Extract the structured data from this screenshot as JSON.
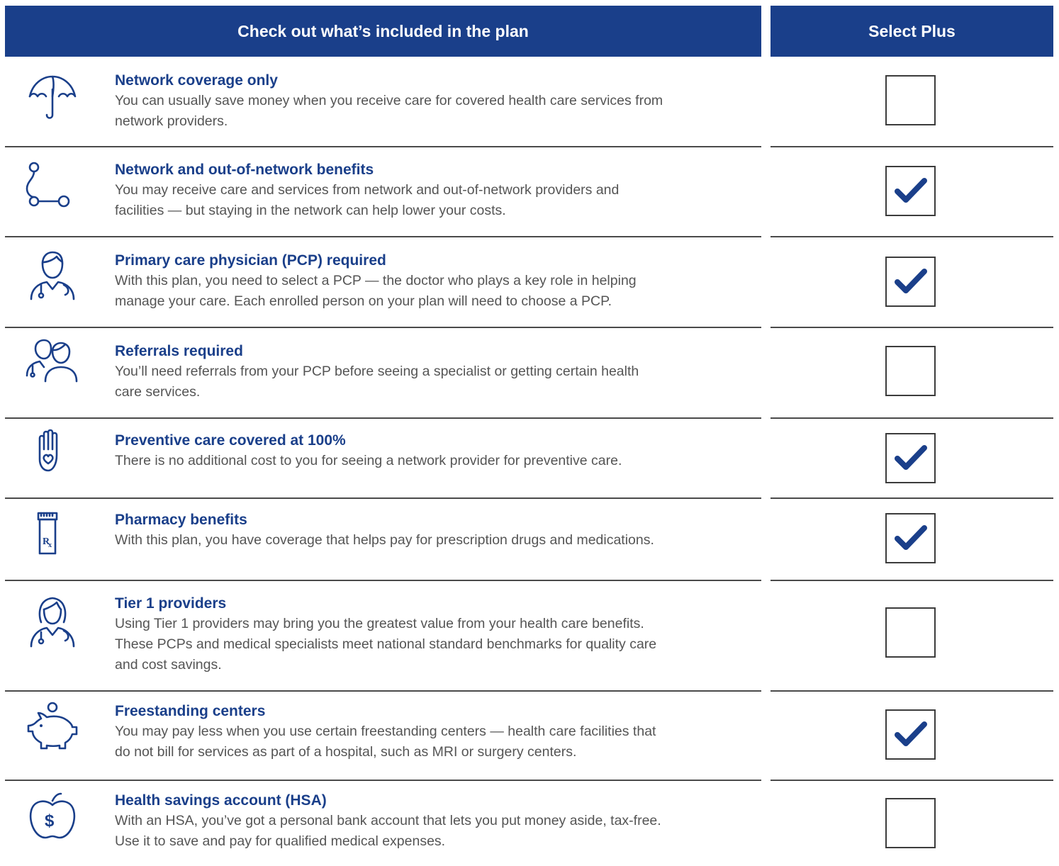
{
  "header": {
    "features_title": "Check out what’s included in the plan",
    "plan_name": "Select Plus"
  },
  "colors": {
    "brand_blue": "#1a3f8a",
    "body_text": "#555555",
    "divider": "#4a4a4a"
  },
  "features": [
    {
      "icon": "umbrella-icon",
      "title": "Network coverage only",
      "desc_lines": [
        "You can usually save money when you receive care for covered health care services from",
        "network providers."
      ],
      "included": false
    },
    {
      "icon": "route-icon",
      "title": "Network and out-of-network benefits",
      "desc_lines": [
        "You may receive care and services from network and out-of-network providers and",
        "facilities — but staying in the network can help lower your costs."
      ],
      "included": true
    },
    {
      "icon": "doctor-icon",
      "title": "Primary care physician (PCP) required",
      "desc_lines": [
        "With this plan, you need to select a PCP — the doctor who plays a key role in helping",
        "manage your care. Each enrolled person on your plan will need to choose a PCP."
      ],
      "included": true
    },
    {
      "icon": "referral-people-icon",
      "title": "Referrals required",
      "desc_lines": [
        "You’ll need referrals from your PCP before seeing a specialist or getting certain health",
        "care services."
      ],
      "included": false
    },
    {
      "icon": "hand-heart-icon",
      "title": "Preventive care covered at 100%",
      "desc_lines": [
        "There is no additional cost to you for seeing a network provider for preventive care."
      ],
      "included": true
    },
    {
      "icon": "prescription-bottle-icon",
      "title": "Pharmacy benefits",
      "desc_lines": [
        "With this plan, you have coverage that helps pay for prescription drugs and medications."
      ],
      "included": true
    },
    {
      "icon": "female-doctor-icon",
      "title": "Tier 1 providers",
      "desc_lines": [
        "Using Tier 1 providers may bring you the greatest value from your health care benefits.",
        "These PCPs and medical specialists meet national standard benchmarks for quality care",
        "and cost savings."
      ],
      "included": false
    },
    {
      "icon": "piggy-bank-icon",
      "title": "Freestanding centers",
      "desc_lines": [
        "You may pay less when you use certain freestanding centers — health care facilities that",
        "do not bill for services as part of a hospital, such as MRI or surgery centers."
      ],
      "included": true
    },
    {
      "icon": "apple-dollar-icon",
      "title": "Health savings account (HSA)",
      "desc_lines": [
        "With an HSA, you’ve got a personal bank account that lets you put money aside, tax-free.",
        "Use it to save and pay for qualified medical expenses."
      ],
      "included": false
    }
  ]
}
